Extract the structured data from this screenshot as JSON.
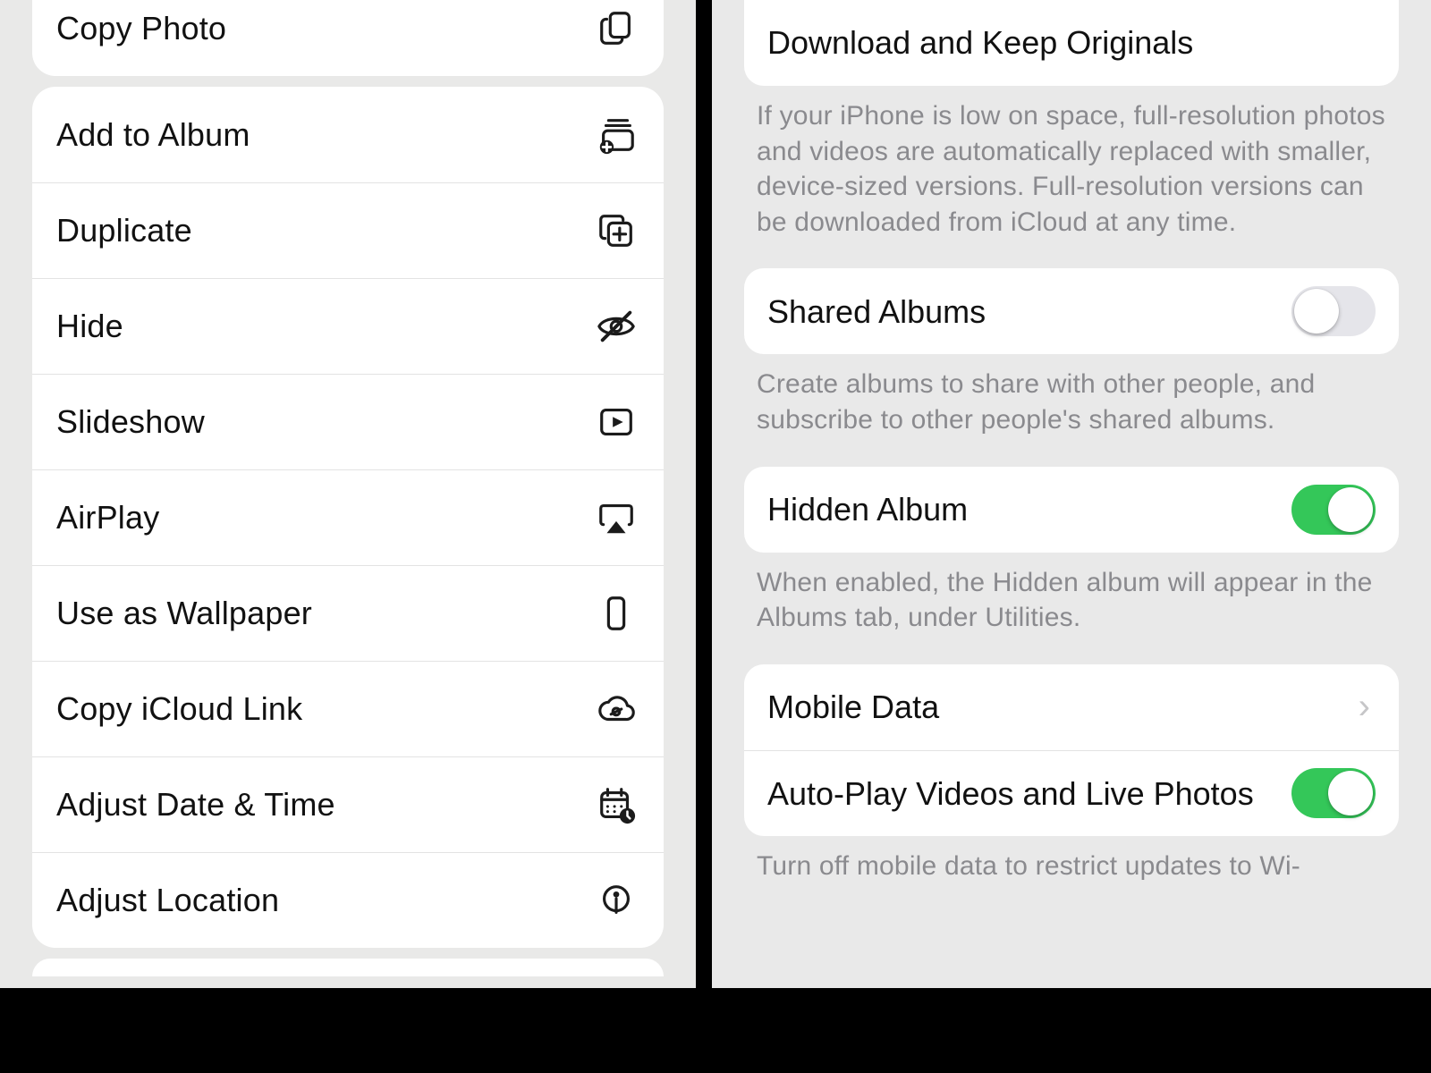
{
  "left": {
    "actions": {
      "copy_photo": "Copy Photo",
      "add_to_album": "Add to Album",
      "duplicate": "Duplicate",
      "hide": "Hide",
      "slideshow": "Slideshow",
      "airplay": "AirPlay",
      "use_as_wallpaper": "Use as Wallpaper",
      "copy_icloud_link": "Copy iCloud Link",
      "adjust_date_time": "Adjust Date & Time",
      "adjust_location": "Adjust Location"
    }
  },
  "right": {
    "download": {
      "label": "Download and Keep Originals",
      "footer": "If your iPhone is low on space, full-resolution photos and videos are automatically replaced with smaller, device-sized versions. Full-resolution versions can be downloaded from iCloud at any time."
    },
    "shared_albums": {
      "label": "Shared Albums",
      "on": false,
      "footer": "Create albums to share with other people, and subscribe to other people's shared albums."
    },
    "hidden_album": {
      "label": "Hidden Album",
      "on": true,
      "footer": "When enabled, the Hidden album will appear in the Albums tab, under Utilities."
    },
    "mobile_data": {
      "label": "Mobile Data"
    },
    "autoplay": {
      "label": "Auto-Play Videos and Live Photos",
      "on": true
    },
    "bottom_footer": "Turn off mobile data to restrict updates to Wi-"
  }
}
